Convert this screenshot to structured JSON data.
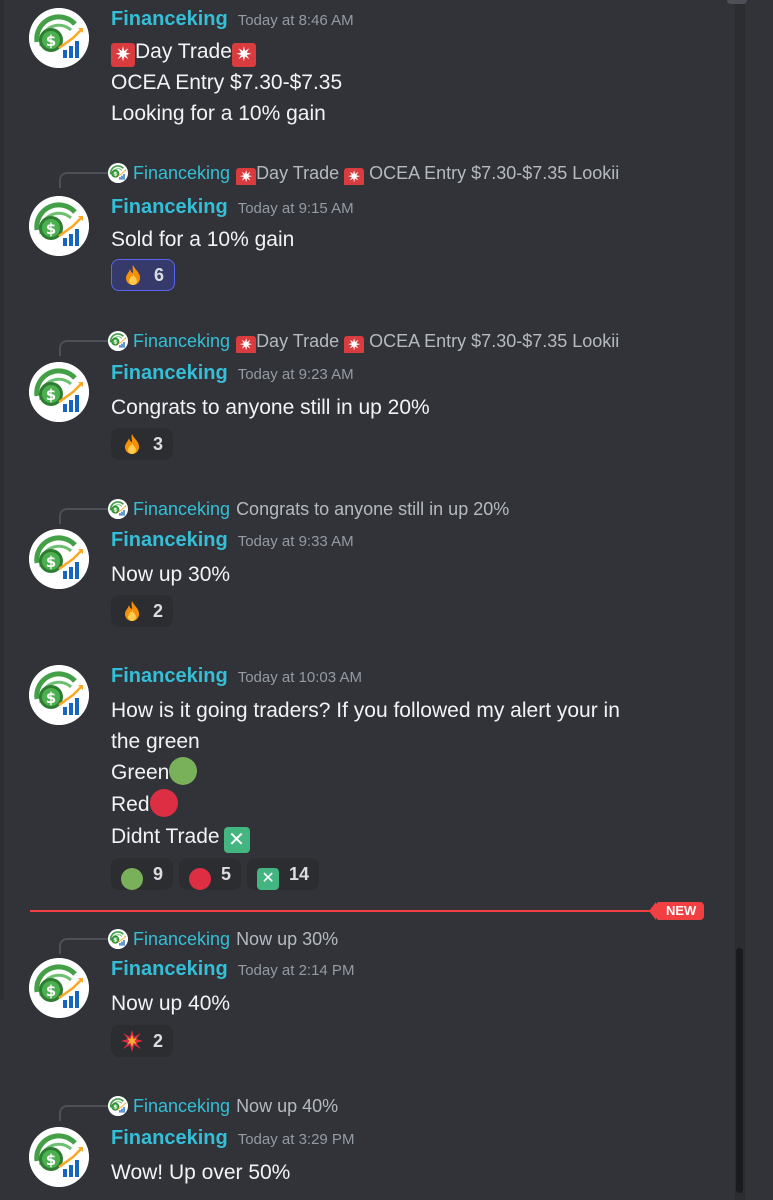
{
  "author": "Financeking",
  "colors": {
    "author": "#34bfd8",
    "background": "#313338",
    "new_divider": "#f23f42",
    "accent_reaction": "#5865f2"
  },
  "messages": [
    {
      "time": "Today at 8:46 AM",
      "lines": [
        "Day Trade",
        "OCEA Entry $7.30-$7.35",
        "Looking for a 10% gain"
      ]
    },
    {
      "reply": {
        "author": "Financeking",
        "text_a": "Day Trade",
        "text_b": "OCEA Entry $7.30-$7.35 Lookii"
      },
      "time": "Today at 9:15 AM",
      "lines": [
        "Sold for a 10% gain"
      ],
      "reactions": [
        {
          "icon": "fire-icon",
          "count": "6",
          "selected": true
        }
      ]
    },
    {
      "reply": {
        "author": "Financeking",
        "text_a": "Day Trade",
        "text_b": "OCEA Entry $7.30-$7.35 Lookii"
      },
      "time": "Today at 9:23 AM",
      "lines": [
        "Congrats to anyone still in up 20%"
      ],
      "reactions": [
        {
          "icon": "fire-icon",
          "count": "3"
        }
      ]
    },
    {
      "reply": {
        "author": "Financeking",
        "text": "Congrats to anyone still in up 20%"
      },
      "time": "Today at 9:33 AM",
      "lines": [
        "Now up 30%"
      ],
      "reactions": [
        {
          "icon": "fire-icon",
          "count": "2"
        }
      ]
    },
    {
      "time": "Today at 10:03 AM",
      "lines": [
        "How is it going traders? If you followed my alert your in",
        "the green",
        "Green",
        "Red",
        "Didnt Trade"
      ],
      "reactions": [
        {
          "icon": "green-circle-icon",
          "count": "9"
        },
        {
          "icon": "red-circle-icon",
          "count": "5"
        },
        {
          "icon": "x-mark-icon",
          "count": "14"
        }
      ]
    },
    {
      "reply": {
        "author": "Financeking",
        "text": "Now up 30%"
      },
      "time": "Today at 2:14 PM",
      "lines": [
        "Now up 40%"
      ],
      "reactions": [
        {
          "icon": "collision-icon",
          "count": "2"
        }
      ]
    },
    {
      "reply": {
        "author": "Financeking",
        "text": "Now up 40%"
      },
      "time": "Today at 3:29 PM",
      "lines": [
        "Wow! Up over 50%"
      ]
    }
  ],
  "new_divider": {
    "label": "NEW"
  }
}
